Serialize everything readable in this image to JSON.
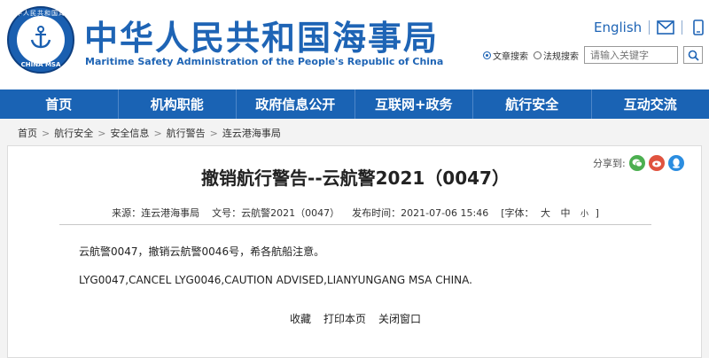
{
  "header": {
    "logo_top": "中华人民共和国海事局",
    "logo_bottom": "CHINA MSA",
    "site_title": "中华人民共和国海事局",
    "site_subtitle": "Maritime Safety Administration of the People's Republic of China",
    "lang_link": "English",
    "mail_icon": "mail-icon",
    "app_icon": "phone-icon",
    "search": {
      "radio1": "文章搜索",
      "radio2": "法规搜索",
      "placeholder": "请输入关键字"
    }
  },
  "nav": [
    "首页",
    "机构职能",
    "政府信息公开",
    "互联网+政务",
    "航行安全",
    "互动交流"
  ],
  "breadcrumb": [
    "首页",
    "航行安全",
    "安全信息",
    "航行警告",
    "连云港海事局"
  ],
  "article": {
    "share_label": "分享到:",
    "title": "撤销航行警告--云航警2021（0047）",
    "source": "来源：连云港海事局",
    "doc_no": "文号：云航警2021（0047）",
    "pub_time": "发布时间：2021-07-06 15:46",
    "font_label": "[字体：",
    "font_big": "大",
    "font_mid": "中",
    "font_small": "小",
    "font_end": "]",
    "para_cn": "云航警0047，撤销云航警0046号，希各航船注意。",
    "para_en": "LYG0047,CANCEL LYG0046,CAUTION ADVISED,LIANYUNGANG MSA CHINA.",
    "actions": [
      "收藏",
      "打印本页",
      "关闭窗口"
    ]
  },
  "colors": {
    "brand": "#1a63b4",
    "wechat": "#4caf50",
    "weibo": "#e0533f",
    "qq": "#2b8de0"
  }
}
